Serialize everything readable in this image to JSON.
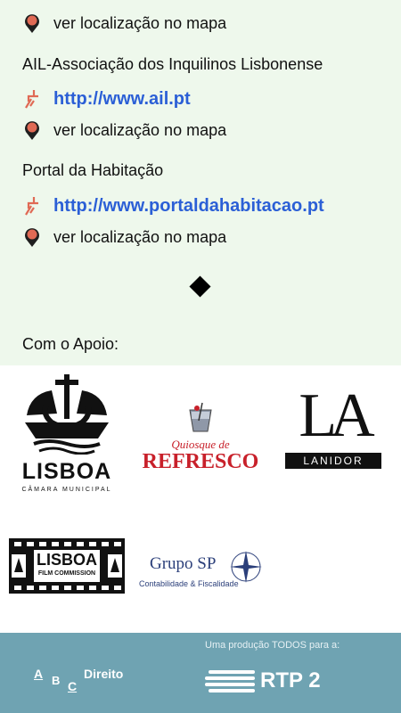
{
  "entries": [
    {
      "map_label": "ver localização no mapa"
    },
    {
      "org": "AIL-Associação dos Inquilinos Lisbonense",
      "url": "http://www.ail.pt",
      "map_label": "ver localização no mapa"
    },
    {
      "org": "Portal da Habitação",
      "url": "http://www.portaldahabitacao.pt",
      "map_label": "ver localização no mapa"
    }
  ],
  "support_heading": "Com o Apoio:",
  "logos": {
    "lisboa": {
      "name": "LISBOA",
      "sub": "CÂMARA MUNICIPAL"
    },
    "quiosque": {
      "line1": "Quiosque de",
      "line2": "REFRESCO"
    },
    "lanidor": {
      "mark": "LA",
      "name": "LANIDOR"
    },
    "film": {
      "line1": "LISBOA",
      "line2": "FILM COMMISSION"
    },
    "gruposp": {
      "brand": "Grupo SP",
      "tag": "Contabilidade & Fiscalidade"
    }
  },
  "footer": {
    "production": "Uma produção TODOS para a:",
    "abc": {
      "a": "A",
      "b": "B",
      "c": "C",
      "word": "Direito"
    },
    "rtp": "RTP 2"
  },
  "colors": {
    "bg": "#eef8ec",
    "link": "#2b5fd6",
    "footer": "#6fa3b2",
    "pin": "#e06a55",
    "refresco": "#c8202a"
  }
}
